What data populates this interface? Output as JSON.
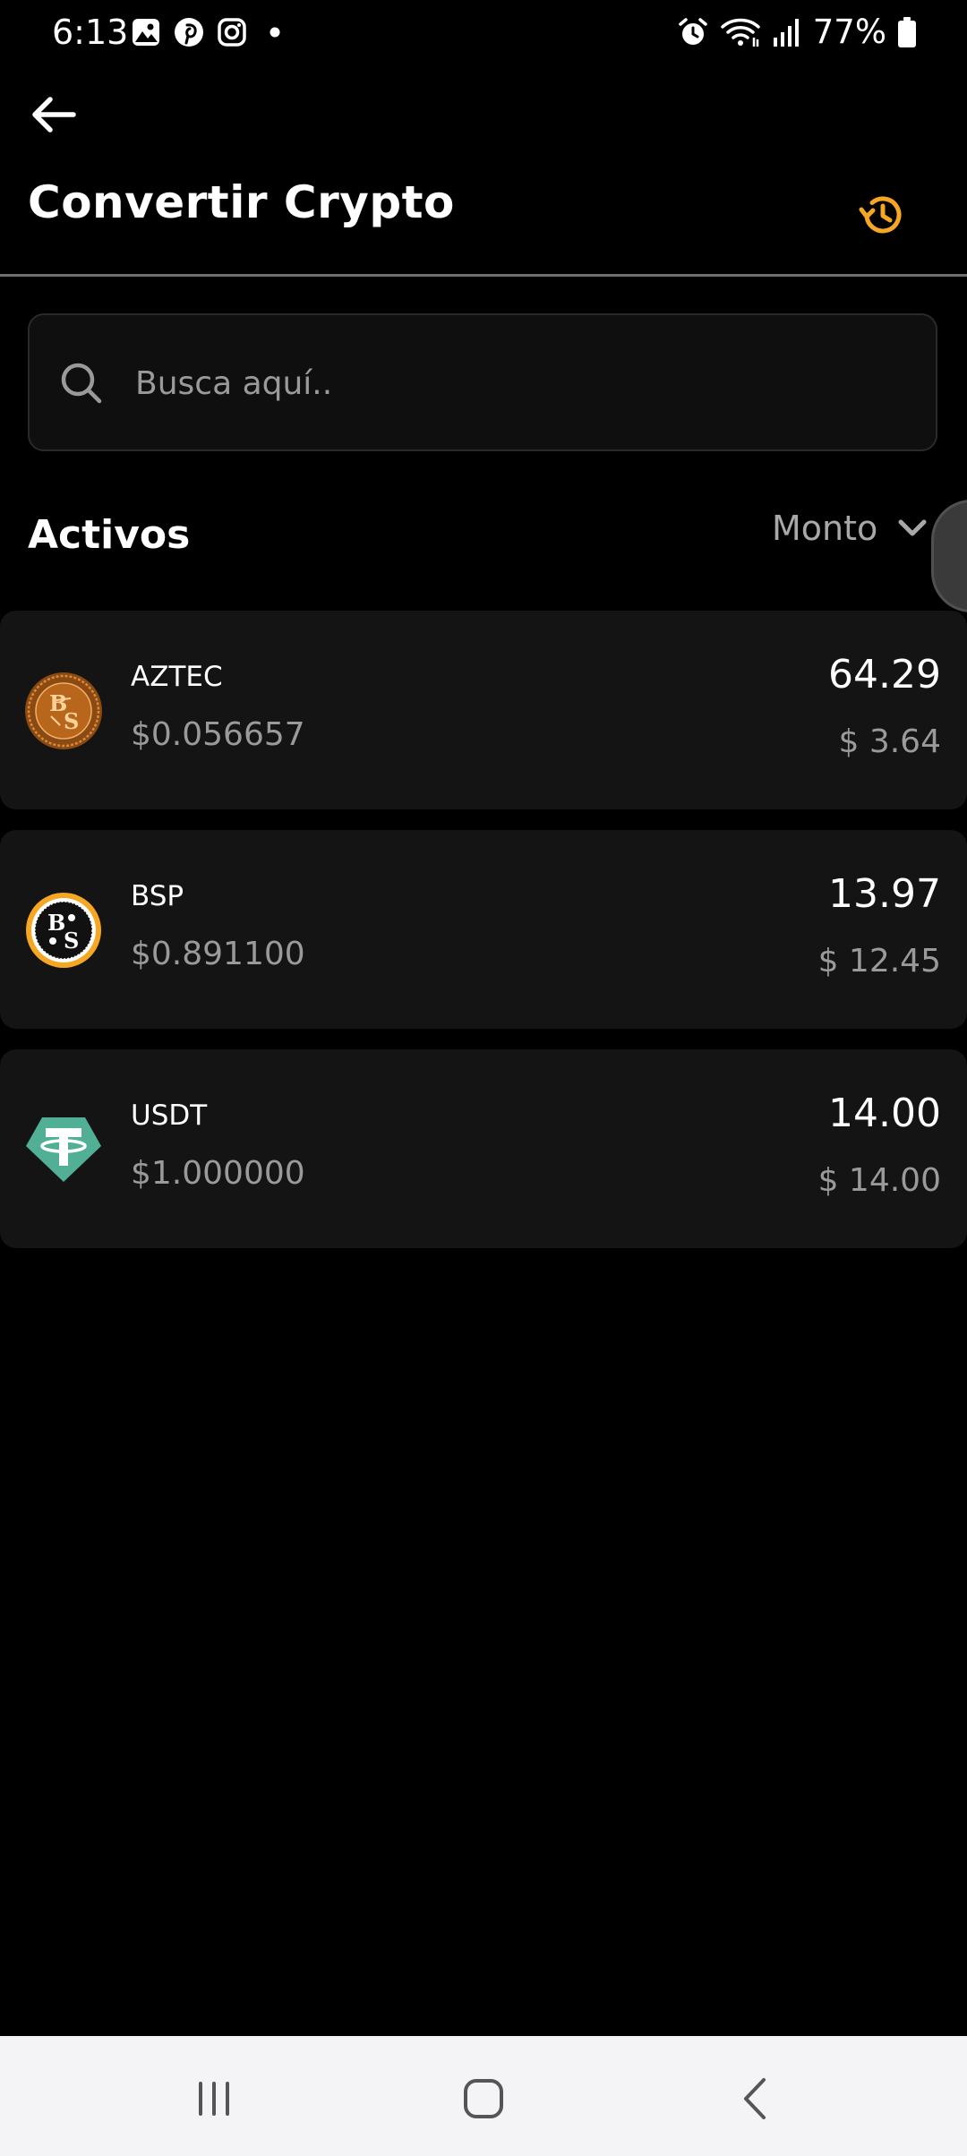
{
  "status_bar": {
    "time": "6:13",
    "battery_percent": "77%",
    "left_icons": [
      "gallery-icon",
      "pinterest-icon",
      "instagram-icon",
      "notification-dot-icon"
    ],
    "right_icons": [
      "alarm-icon",
      "wifi-icon",
      "signal-icon",
      "battery-icon"
    ]
  },
  "header": {
    "title": "Convertir Crypto",
    "back_icon": "arrow-left-icon",
    "history_icon": "history-icon"
  },
  "search": {
    "placeholder": "Busca aquí..",
    "value": ""
  },
  "section": {
    "title": "Activos",
    "sort_label": "Monto"
  },
  "assets": [
    {
      "symbol": "AZTEC",
      "price": "$0.056657",
      "amount": "64.29",
      "value": "$ 3.64",
      "logo": "aztec-coin-icon"
    },
    {
      "symbol": "BSP",
      "price": "$0.891100",
      "amount": "13.97",
      "value": "$ 12.45",
      "logo": "bsp-coin-icon"
    },
    {
      "symbol": "USDT",
      "price": "$1.000000",
      "amount": "14.00",
      "value": "$ 14.00",
      "logo": "tether-icon"
    }
  ],
  "colors": {
    "background": "#000000",
    "card": "#141414",
    "accent": "#F5A623",
    "muted_text": "#9A9A9A",
    "tether_green": "#50AF95"
  }
}
